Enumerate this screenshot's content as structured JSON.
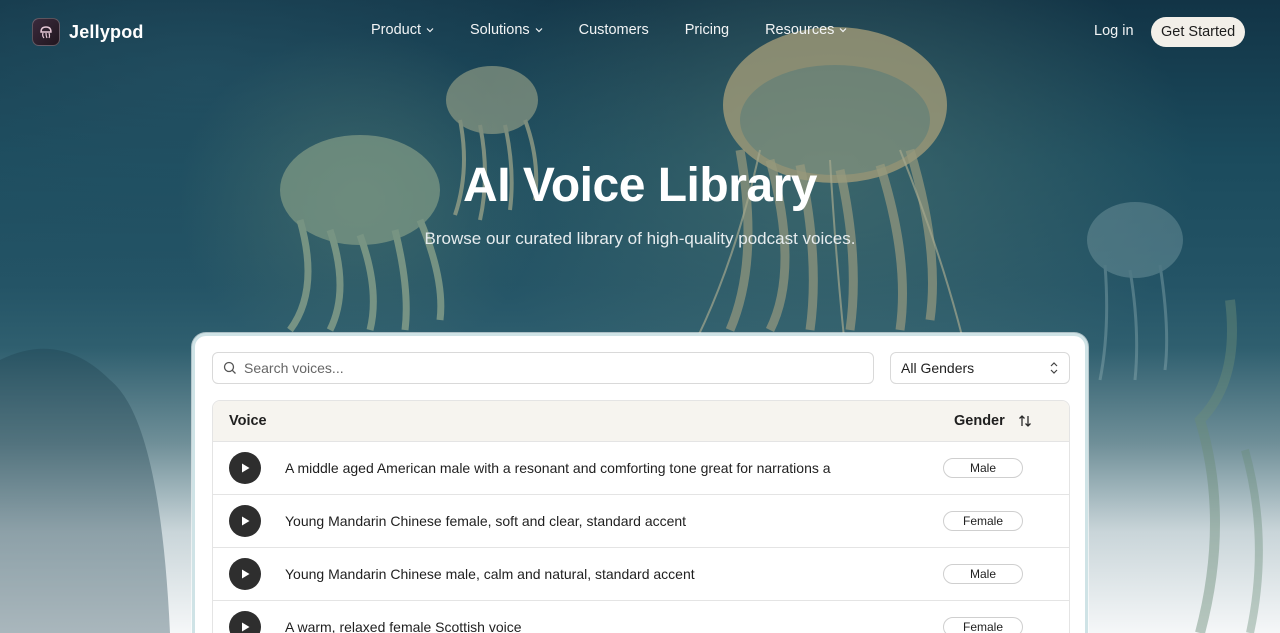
{
  "brand": {
    "name": "Jellypod"
  },
  "nav": {
    "links": [
      {
        "label": "Product",
        "dropdown": true
      },
      {
        "label": "Solutions",
        "dropdown": true
      },
      {
        "label": "Customers",
        "dropdown": false
      },
      {
        "label": "Pricing",
        "dropdown": false
      },
      {
        "label": "Resources",
        "dropdown": true
      }
    ],
    "login_label": "Log in",
    "cta_label": "Get Started"
  },
  "hero": {
    "title": "AI Voice Library",
    "subtitle": "Browse our curated library of high-quality podcast voices."
  },
  "library": {
    "search_placeholder": "Search voices...",
    "gender_filter_value": "All Genders",
    "columns": {
      "voice": "Voice",
      "gender": "Gender"
    },
    "rows": [
      {
        "description": "A middle aged American male with a resonant and comforting tone great for narrations a",
        "gender": "Male"
      },
      {
        "description": "Young Mandarin Chinese female, soft and clear, standard accent",
        "gender": "Female"
      },
      {
        "description": "Young Mandarin Chinese male, calm and natural, standard accent",
        "gender": "Male"
      },
      {
        "description": "A warm, relaxed female Scottish voice",
        "gender": "Female"
      }
    ]
  },
  "icons": {
    "logo": "jellyfish-logo-icon",
    "chevron": "chevron-down-icon",
    "search": "search-icon",
    "select": "select-updown-icon",
    "sort": "sort-arrows-icon",
    "play": "play-icon"
  },
  "colors": {
    "accent_dark": "#2e2e2e",
    "cta_bg": "#f2efe9",
    "table_header_bg": "#f6f4ef",
    "card_border": "#cfe3e6"
  }
}
